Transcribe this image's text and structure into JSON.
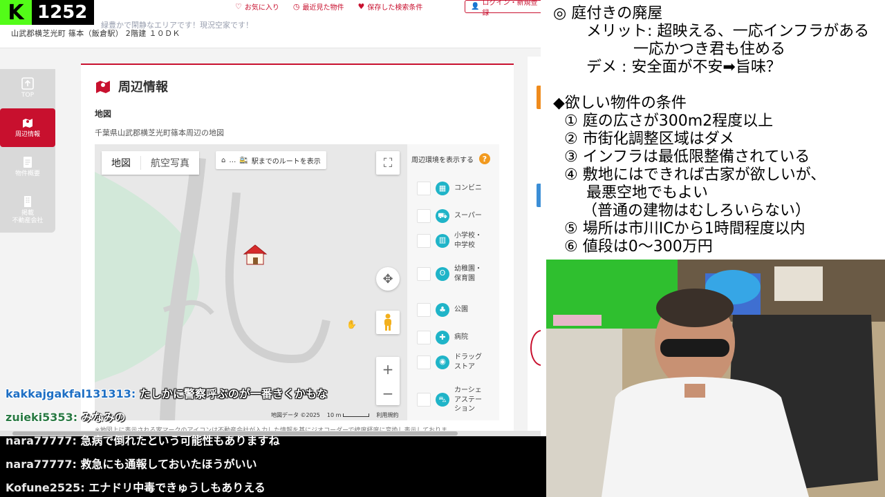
{
  "counter": {
    "logo": "K",
    "viewers": "1252"
  },
  "site": {
    "nav": [
      {
        "icon": "heart-icon",
        "label": "お気に入り"
      },
      {
        "icon": "clock-icon",
        "label": "最近見た物件"
      },
      {
        "icon": "bookmark-icon",
        "label": "保存した検索条件"
      }
    ],
    "login_label": "ログイン・新規登録",
    "notice": "緑豊かで閑静なエリアです！現況空家です！",
    "property_title": "山武郡横芝光町 篠本（飯倉駅） 2階建 １０ＤＫ"
  },
  "sidebar": {
    "items": [
      {
        "label": "TOP",
        "icon": "arrow-up-icon"
      },
      {
        "label": "周辺情報",
        "icon": "map-pin-icon"
      },
      {
        "label": "物件概要",
        "icon": "document-icon"
      },
      {
        "label": "掲載\n不動産会社",
        "icon": "building-icon"
      }
    ]
  },
  "section": {
    "title": "周辺情報",
    "map_label": "地図",
    "map_desc": "千葉県山武郡横芝光町篠本周辺の地図",
    "map_note": "※地図上に表示される家マークのアイコンは不動産会社が入力した情報を基にジオコーダーで緯度経度に変換し表示しておりま"
  },
  "map": {
    "type_map": "地図",
    "type_aerial": "航空写真",
    "route_label": "駅までのルートを表示",
    "attribution": "地図データ ©2025",
    "scale": "10 m",
    "terms": "利用規約",
    "zoom_in": "+",
    "zoom_out": "−"
  },
  "poi": {
    "header": "周辺環境を表示する",
    "help": "?",
    "items": [
      {
        "label": "コンビニ",
        "icon": "convenience-store-icon",
        "glyph": "▦"
      },
      {
        "label": "スーパー",
        "icon": "cart-icon",
        "glyph": "⛟"
      },
      {
        "label": "小学校・\n中学校",
        "icon": "school-icon",
        "glyph": "▥"
      },
      {
        "label": "幼稚園・\n保育園",
        "icon": "kindergarten-icon",
        "glyph": "ʘ"
      },
      {
        "label": "公園",
        "icon": "tree-icon",
        "glyph": "♣"
      },
      {
        "label": "病院",
        "icon": "hospital-icon",
        "glyph": "✚"
      },
      {
        "label": "ドラッグ\nストア",
        "icon": "pill-icon",
        "glyph": "◉"
      },
      {
        "label": "カーシェ\nアステー\nション",
        "icon": "car-icon",
        "glyph": "⛍"
      }
    ]
  },
  "chat": [
    {
      "user": "kakkajgakfal131313:",
      "msg": "たしかに警察呼ぶのが一番きくかもな"
    },
    {
      "user": "zuieki5353:",
      "msg": "みなみの"
    },
    {
      "user": "nara77777:",
      "msg": "急病で倒れたという可能性もありますね"
    },
    {
      "user": "nara77777:",
      "msg": "救急にも通報しておいたほうがいい"
    },
    {
      "user": "Kofune2525:",
      "msg": "エナドリ中毒できゅうしもありえる"
    }
  ],
  "notes": {
    "heading": "◎ 庭付きの廃屋",
    "merit_1": "メリット: 超映える、一応インフラがある",
    "merit_2": "一応かつき君も住める",
    "demerit": "デメ : 安全面が不安➡旨味？",
    "conditions_title": "◆欲しい物件の条件",
    "conditions": [
      "① 庭の広さが300m2程度以上",
      "② 市街化調整区域はダメ",
      "③ インフラは最低限整備されている",
      "④ 敷地にはできれば古家が欲しいが、",
      "最悪空地でもよい",
      "（普通の建物はむしろいらない）",
      "⑤ 場所は市川ICから1時間程度以内",
      "⑥ 値段は0～300万円"
    ]
  },
  "colors": {
    "brand_red": "#c8102e",
    "kick_green": "#53fc18",
    "poi_teal": "#1fb4c8",
    "help_orange": "#f29a1f"
  }
}
